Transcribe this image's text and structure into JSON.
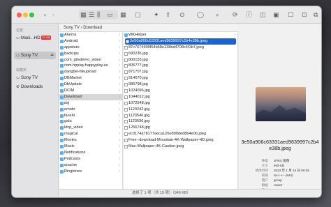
{
  "sidebar": {
    "section_locations": "位置",
    "mac_label": "Maci...HD",
    "mac_badge": "23 GB",
    "sony_label": "Sony TV",
    "section_favorites": "收藏夹",
    "fav_sony": "Sony TV",
    "fav_downloads": "Downloads"
  },
  "pathbar": {
    "text": "Sony TV › Download"
  },
  "column1": [
    "Alarms",
    "Android",
    "appstore",
    "backups",
    "com_gitvdemo_video",
    "com.hppiay.happyplay.ax",
    "dangbei-fileupload",
    "DBMarket",
    "DbUpdate",
    "DCIM",
    "Download",
    "dsj",
    "emotn",
    "fanshi",
    "gala",
    "ktcp_video",
    "magical",
    "Movies",
    "Music",
    "Notifications",
    "Podcasts",
    "qcache",
    "Ringtones"
  ],
  "column2": [
    "WKHelper",
    "3e50a906c63331aed9639997c2b4e38b.jpeg",
    "87c7674999f64b58e138bd4708c4f1b7.jpeg",
    "690236.jpg",
    "800153.jpg",
    "805777.jpg",
    "871707.jpg",
    "914670.jpg",
    "985798.jpg",
    "1024096.jpg",
    "1044012.jpg",
    "1072548.jpg",
    "1120242.jpg",
    "1123546.jpg",
    "1123596.jpg",
    "1256748.jpg",
    "ec0174a7b177aeca126e890ded8b4e0b.jpeg",
    "Free--download-Mountain-4K-Wallpaper-HD.jpeg",
    "Mac-Wallpaper-4K-Caution.jpeg"
  ],
  "preview": {
    "filename": "3e50a906c63331aed9639997c2b4e38b.jpeg",
    "info": [
      {
        "k": "种类",
        "v": "JPEG 图像"
      },
      {
        "k": "大小",
        "v": "949 KB"
      },
      {
        "k": "修改时间",
        "v": "2023 年 1 月 14 日 00:25"
      },
      {
        "k": "权限",
        "v": "rw-r--r-- (644)"
      },
      {
        "k": "用户",
        "v": "group"
      },
      {
        "k": "群组",
        "v": "owner"
      },
      {
        "k": "尺寸",
        "v": "6016 × 3384"
      }
    ]
  },
  "status": {
    "text": "选择了 1 项（共 19 项）（949 KB）"
  },
  "colors": {
    "selection": "#1d62d1",
    "folder": "#5ab0f0"
  }
}
